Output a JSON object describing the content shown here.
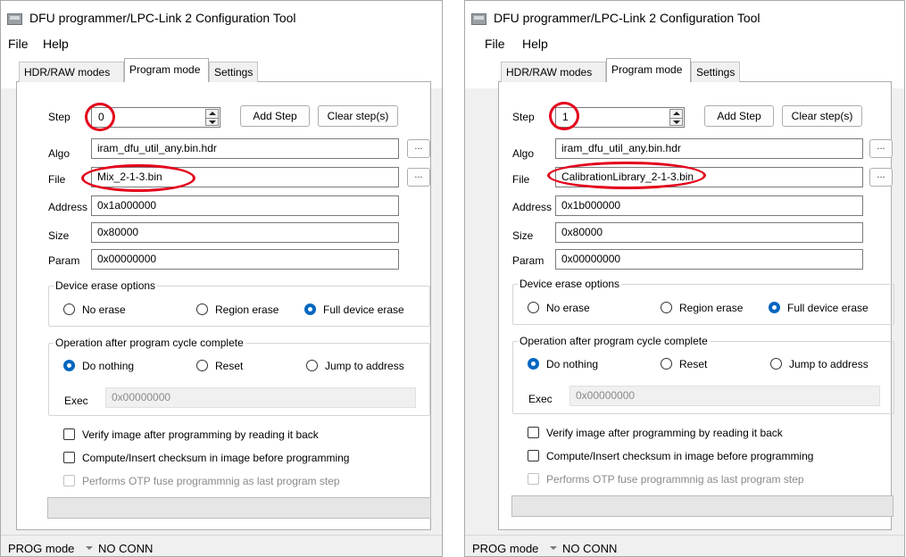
{
  "accent_color": "#0067c0",
  "highlight_color": "#e3001b",
  "windows": [
    {
      "title": "DFU programmer/LPC-Link 2 Configuration Tool",
      "menu": [
        "File",
        "Help"
      ],
      "tabs": [
        {
          "label": "HDR/RAW modes",
          "active": false
        },
        {
          "label": "Program mode",
          "active": true
        },
        {
          "label": "Settings",
          "active": false
        }
      ],
      "step": {
        "label": "Step",
        "value": "0"
      },
      "add_step_label": "Add Step",
      "clear_steps_label": "Clear step(s)",
      "browse_label": "...",
      "algo": {
        "label": "Algo",
        "value": "iram_dfu_util_any.bin.hdr"
      },
      "file": {
        "label": "File",
        "value": "Mix_2-1-3.bin"
      },
      "address": {
        "label": "Address",
        "value": "0x1a000000"
      },
      "size": {
        "label": "Size",
        "value": "0x80000"
      },
      "param": {
        "label": "Param",
        "value": "0x00000000"
      },
      "erase": {
        "title": "Device erase options",
        "options": [
          "No erase",
          "Region erase",
          "Full device erase"
        ],
        "selected": "Full device erase"
      },
      "after": {
        "title": "Operation after program cycle complete",
        "options": [
          "Do nothing",
          "Reset",
          "Jump to address"
        ],
        "selected": "Do nothing",
        "exec_label": "Exec",
        "exec_value": "0x00000000"
      },
      "checkboxes": [
        {
          "label": "Verify image after programming by reading it back",
          "enabled": true,
          "checked": false
        },
        {
          "label": "Compute/Insert checksum in image before programming",
          "enabled": true,
          "checked": false
        },
        {
          "label": "Performs OTP fuse programmnig as last program step",
          "enabled": false,
          "checked": false
        }
      ],
      "status": {
        "mode": "PROG mode",
        "conn": "NO CONN"
      }
    },
    {
      "title": "DFU programmer/LPC-Link 2 Configuration Tool",
      "menu": [
        "File",
        "Help"
      ],
      "tabs": [
        {
          "label": "HDR/RAW modes",
          "active": false
        },
        {
          "label": "Program mode",
          "active": true
        },
        {
          "label": "Settings",
          "active": false
        }
      ],
      "step": {
        "label": "Step",
        "value": "1"
      },
      "add_step_label": "Add Step",
      "clear_steps_label": "Clear step(s)",
      "browse_label": "...",
      "algo": {
        "label": "Algo",
        "value": "iram_dfu_util_any.bin.hdr"
      },
      "file": {
        "label": "File",
        "value": "CalibrationLibrary_2-1-3.bin"
      },
      "address": {
        "label": "Address",
        "value": "0x1b000000"
      },
      "size": {
        "label": "Size",
        "value": "0x80000"
      },
      "param": {
        "label": "Param",
        "value": "0x00000000"
      },
      "erase": {
        "title": "Device erase options",
        "options": [
          "No erase",
          "Region erase",
          "Full device erase"
        ],
        "selected": "Full device erase"
      },
      "after": {
        "title": "Operation after program cycle complete",
        "options": [
          "Do nothing",
          "Reset",
          "Jump to address"
        ],
        "selected": "Do nothing",
        "exec_label": "Exec",
        "exec_value": "0x00000000"
      },
      "checkboxes": [
        {
          "label": "Verify image after programming by reading it back",
          "enabled": true,
          "checked": false
        },
        {
          "label": "Compute/Insert checksum in image before programming",
          "enabled": true,
          "checked": false
        },
        {
          "label": "Performs OTP fuse programmnig as last program step",
          "enabled": false,
          "checked": false
        }
      ],
      "status": {
        "mode": "PROG mode",
        "conn": "NO CONN"
      }
    }
  ]
}
